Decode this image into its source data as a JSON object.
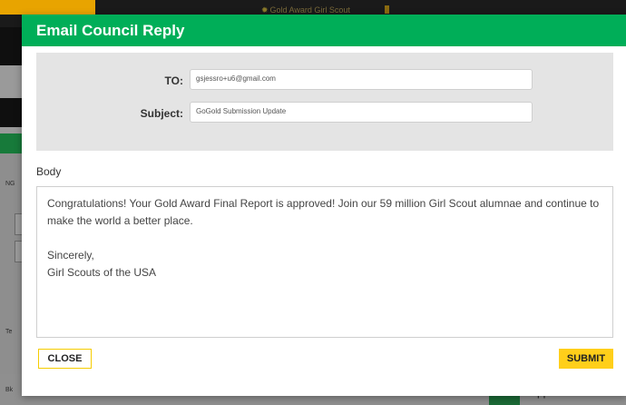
{
  "background": {
    "header_center_text": "Gold Award Girl Scout",
    "left_label_top": "NG",
    "left_label_mid": "Te",
    "left_label_bottom": "Bk",
    "approval_text": "Approval on"
  },
  "modal": {
    "title": "Email Council Reply",
    "to_label": "TO:",
    "to_value": "gsjessro+u6@gmail.com",
    "subject_label": "Subject:",
    "subject_value": "GoGold Submission Update",
    "body_label": "Body",
    "body_text": "Congratulations! Your Gold Award Final Report is approved! Join our 59 million Girl Scout alumnae and continue to make the world a better place.\n\nSincerely,\nGirl Scouts of the USA",
    "close_label": "CLOSE",
    "submit_label": "SUBMIT"
  },
  "colors": {
    "header_green": "#00ae58",
    "button_yellow": "#ffcf1a",
    "panel_gray": "#e4e4e4"
  }
}
